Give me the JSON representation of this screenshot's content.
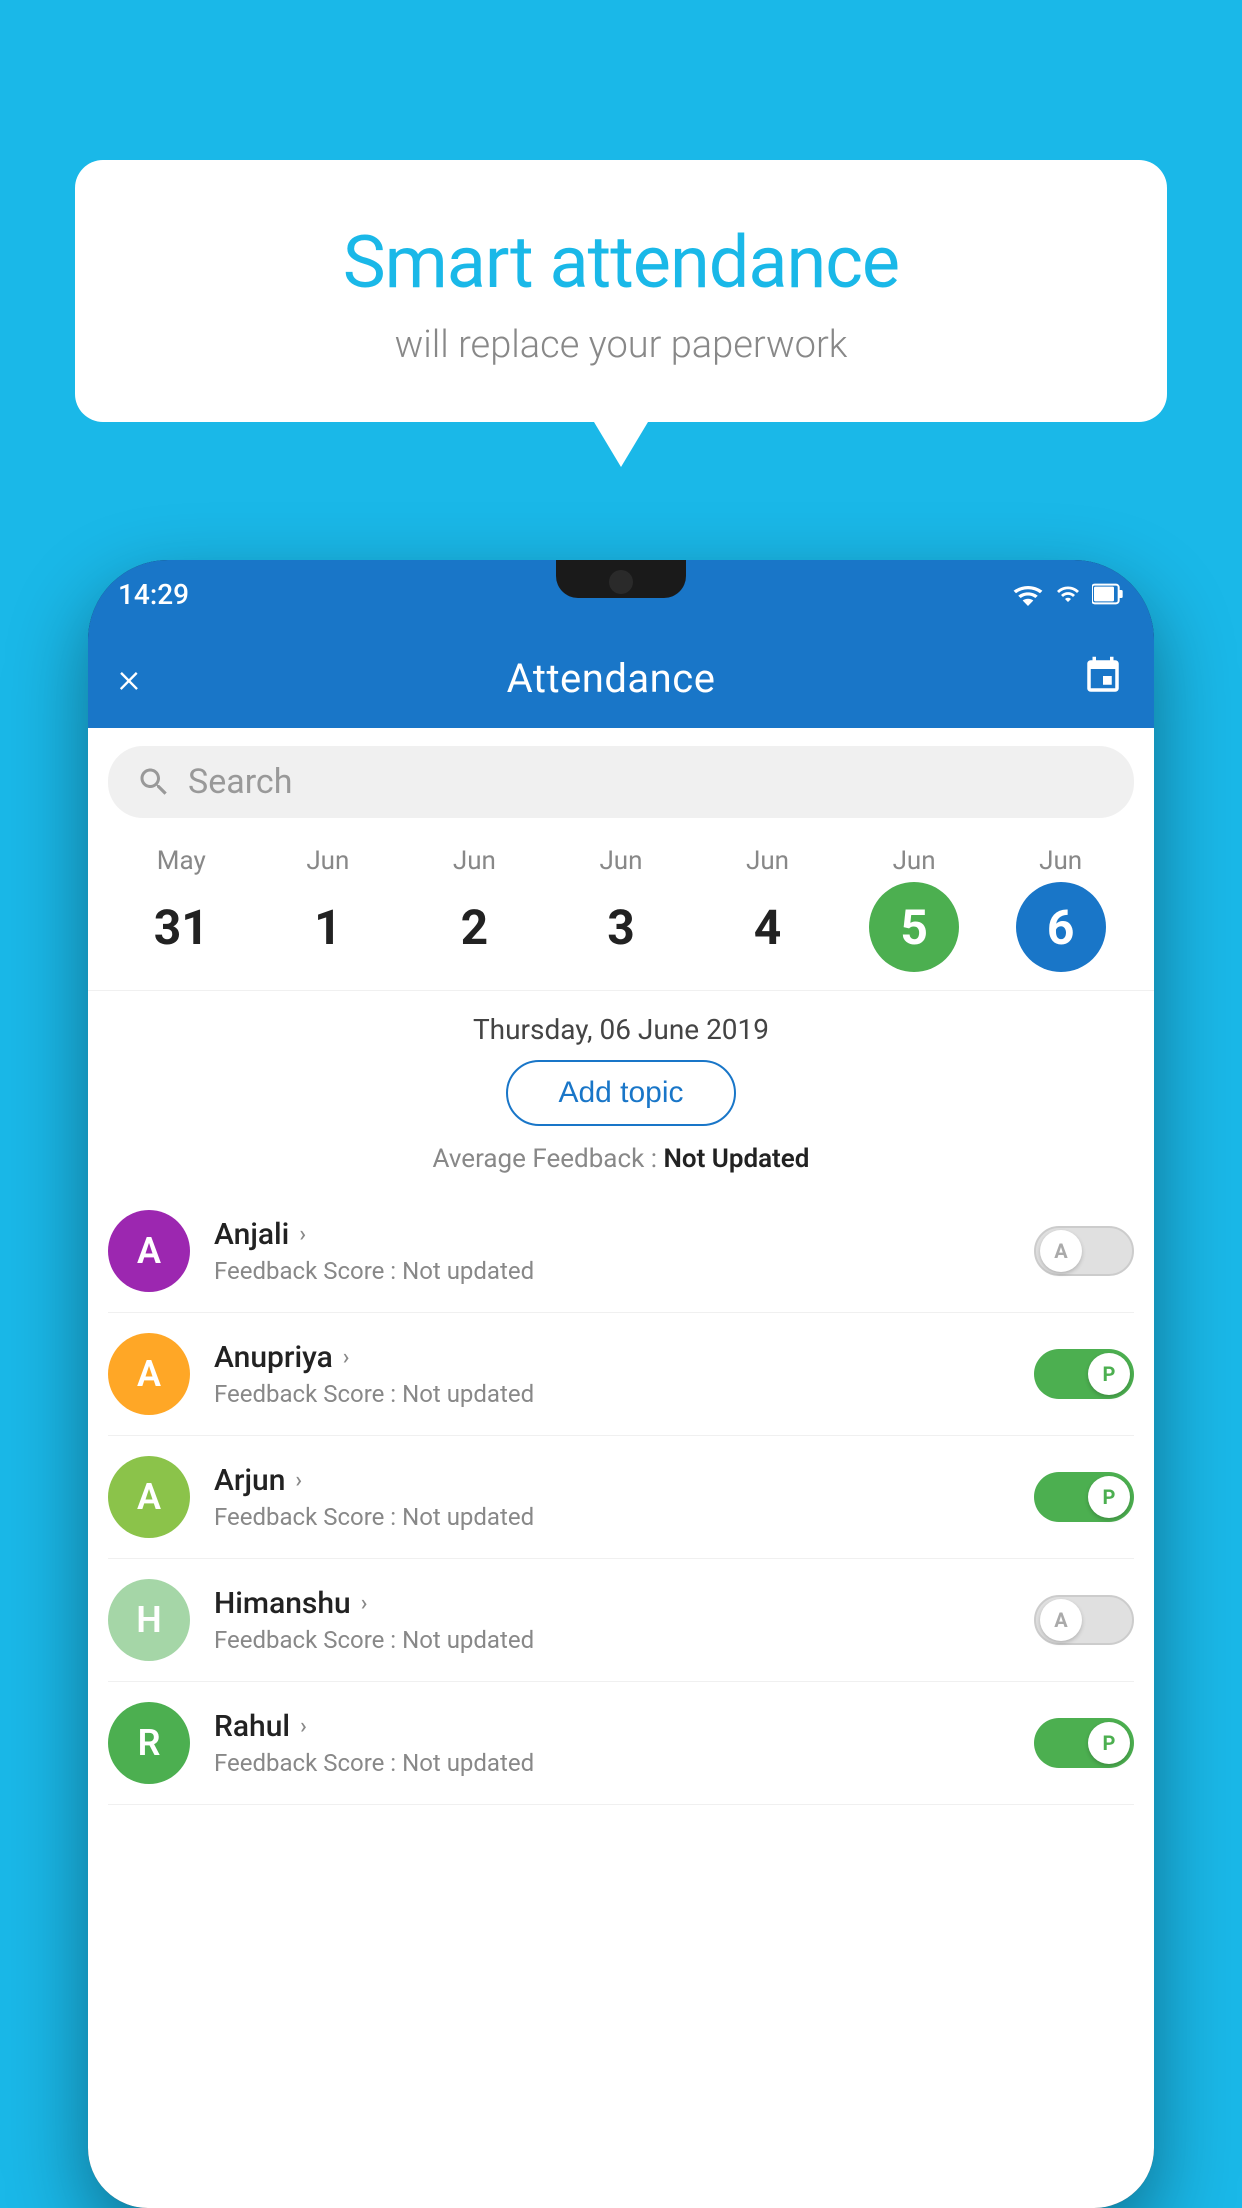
{
  "background_color": "#1ab8e8",
  "bubble": {
    "title": "Smart attendance",
    "subtitle": "will replace your paperwork"
  },
  "status_bar": {
    "time": "14:29",
    "icons": [
      "wifi",
      "signal",
      "battery"
    ]
  },
  "app_bar": {
    "title": "Attendance",
    "close_label": "×",
    "calendar_label": "calendar"
  },
  "search": {
    "placeholder": "Search"
  },
  "calendar": {
    "days": [
      {
        "month": "May",
        "date": "31",
        "style": "normal"
      },
      {
        "month": "Jun",
        "date": "1",
        "style": "normal"
      },
      {
        "month": "Jun",
        "date": "2",
        "style": "normal"
      },
      {
        "month": "Jun",
        "date": "3",
        "style": "normal"
      },
      {
        "month": "Jun",
        "date": "4",
        "style": "normal"
      },
      {
        "month": "Jun",
        "date": "5",
        "style": "today"
      },
      {
        "month": "Jun",
        "date": "6",
        "style": "selected"
      }
    ]
  },
  "selected_date": "Thursday, 06 June 2019",
  "add_topic_label": "Add topic",
  "avg_feedback_label": "Average Feedback :",
  "avg_feedback_value": "Not Updated",
  "students": [
    {
      "name": "Anjali",
      "avatar_letter": "A",
      "avatar_color": "#9c27b0",
      "feedback": "Feedback Score : Not updated",
      "status": "absent"
    },
    {
      "name": "Anupriya",
      "avatar_letter": "A",
      "avatar_color": "#ffa726",
      "feedback": "Feedback Score : Not updated",
      "status": "present"
    },
    {
      "name": "Arjun",
      "avatar_letter": "A",
      "avatar_color": "#8bc34a",
      "feedback": "Feedback Score : Not updated",
      "status": "present"
    },
    {
      "name": "Himanshu",
      "avatar_letter": "H",
      "avatar_color": "#a5d6a7",
      "feedback": "Feedback Score : Not updated",
      "status": "absent"
    },
    {
      "name": "Rahul",
      "avatar_letter": "R",
      "avatar_color": "#4caf50",
      "feedback": "Feedback Score : Not updated",
      "status": "present"
    }
  ]
}
